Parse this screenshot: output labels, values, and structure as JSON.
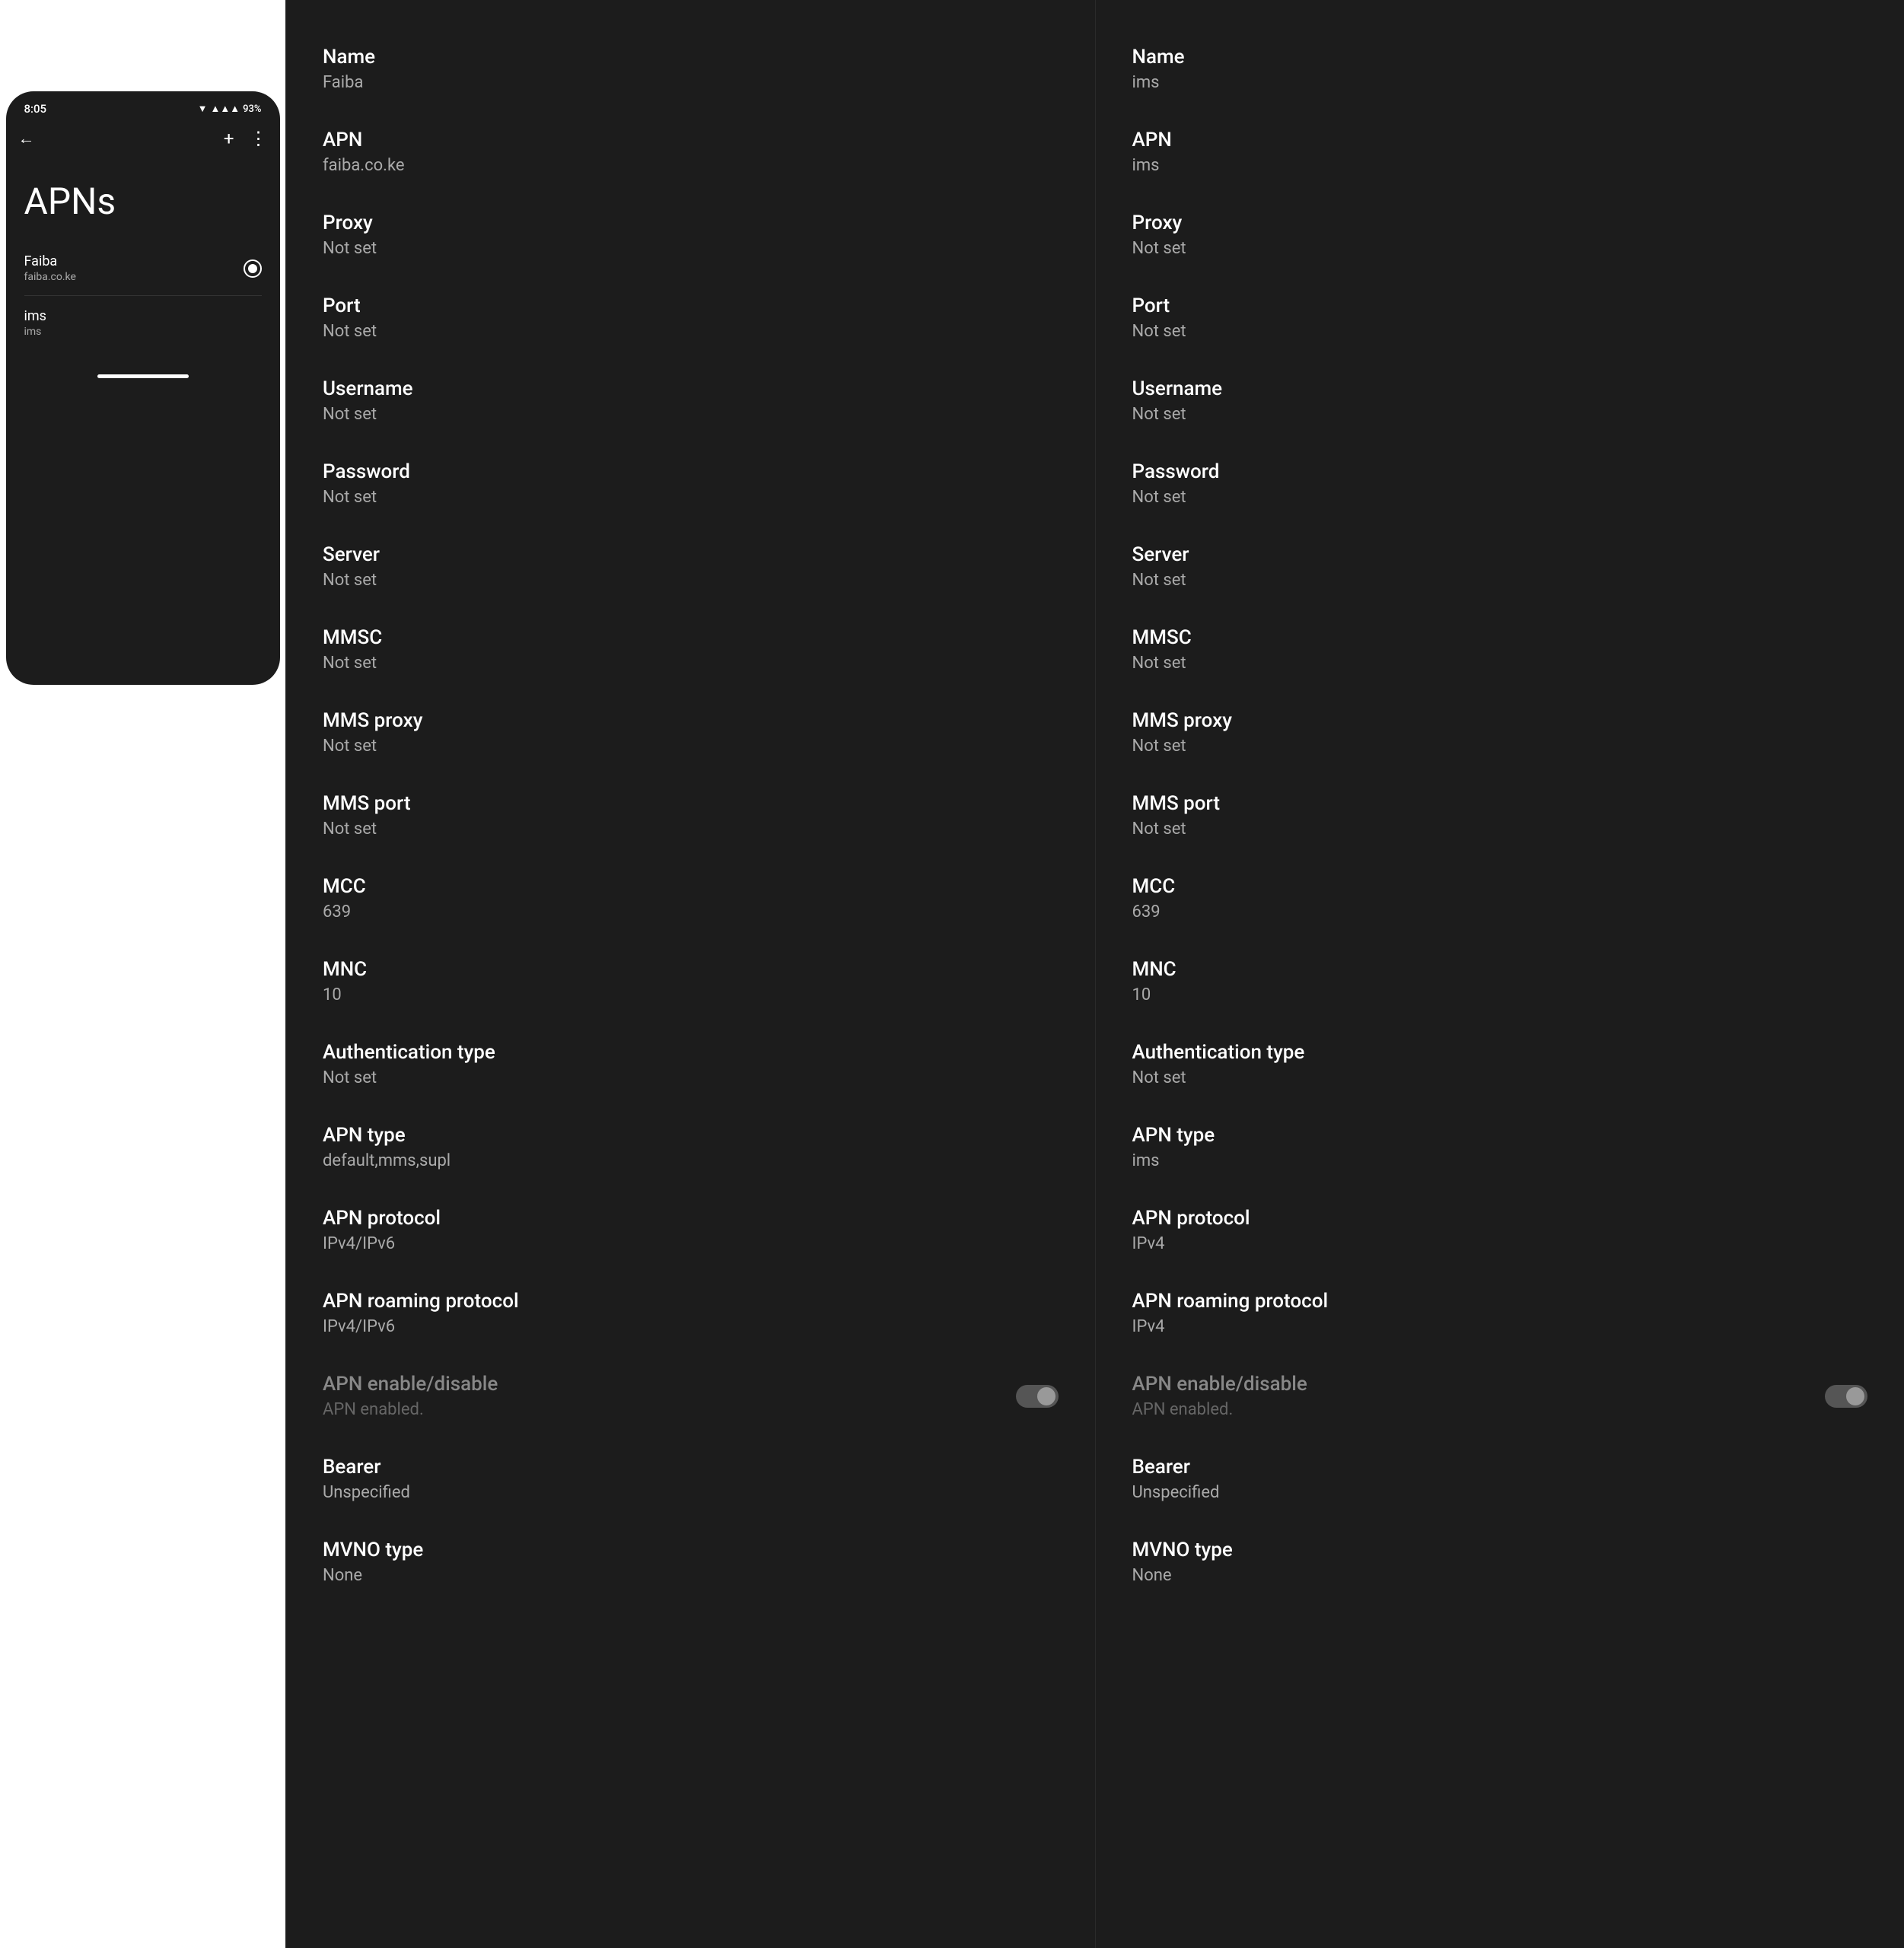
{
  "phone": {
    "time": "8:05",
    "battery": "93%",
    "title": "APNs",
    "back_label": "←",
    "add_label": "+",
    "more_label": "⋮",
    "apns": [
      {
        "name": "Faiba",
        "sub": "faiba.co.ke",
        "selected": true
      },
      {
        "name": "ims",
        "sub": "ims",
        "selected": false
      }
    ]
  },
  "faiba": {
    "fields": [
      {
        "label": "Name",
        "value": "Faiba"
      },
      {
        "label": "APN",
        "value": "faiba.co.ke"
      },
      {
        "label": "Proxy",
        "value": "Not set"
      },
      {
        "label": "Port",
        "value": "Not set"
      },
      {
        "label": "Username",
        "value": "Not set"
      },
      {
        "label": "Password",
        "value": "Not set"
      },
      {
        "label": "Server",
        "value": "Not set"
      },
      {
        "label": "MMSC",
        "value": "Not set"
      },
      {
        "label": "MMS proxy",
        "value": "Not set"
      },
      {
        "label": "MMS port",
        "value": "Not set"
      },
      {
        "label": "MCC",
        "value": "639"
      },
      {
        "label": "MNC",
        "value": "10"
      },
      {
        "label": "Authentication type",
        "value": "Not set"
      },
      {
        "label": "APN type",
        "value": "default,mms,supl"
      },
      {
        "label": "APN protocol",
        "value": "IPv4/IPv6"
      },
      {
        "label": "APN roaming protocol",
        "value": "IPv4/IPv6"
      }
    ],
    "toggle_label": "APN enable/disable",
    "toggle_sub": "APN enabled.",
    "extra_fields": [
      {
        "label": "Bearer",
        "value": "Unspecified"
      },
      {
        "label": "MVNO type",
        "value": "None"
      }
    ]
  },
  "ims": {
    "fields": [
      {
        "label": "Name",
        "value": "ims"
      },
      {
        "label": "APN",
        "value": "ims"
      },
      {
        "label": "Proxy",
        "value": "Not set"
      },
      {
        "label": "Port",
        "value": "Not set"
      },
      {
        "label": "Username",
        "value": "Not set"
      },
      {
        "label": "Password",
        "value": "Not set"
      },
      {
        "label": "Server",
        "value": "Not set"
      },
      {
        "label": "MMSC",
        "value": "Not set"
      },
      {
        "label": "MMS proxy",
        "value": "Not set"
      },
      {
        "label": "MMS port",
        "value": "Not set"
      },
      {
        "label": "MCC",
        "value": "639"
      },
      {
        "label": "MNC",
        "value": "10"
      },
      {
        "label": "Authentication type",
        "value": "Not set"
      },
      {
        "label": "APN type",
        "value": "ims"
      },
      {
        "label": "APN protocol",
        "value": "IPv4"
      },
      {
        "label": "APN roaming protocol",
        "value": "IPv4"
      }
    ],
    "toggle_label": "APN enable/disable",
    "toggle_sub": "APN enabled.",
    "extra_fields": [
      {
        "label": "Bearer",
        "value": "Unspecified"
      },
      {
        "label": "MVNO type",
        "value": "None"
      }
    ]
  }
}
